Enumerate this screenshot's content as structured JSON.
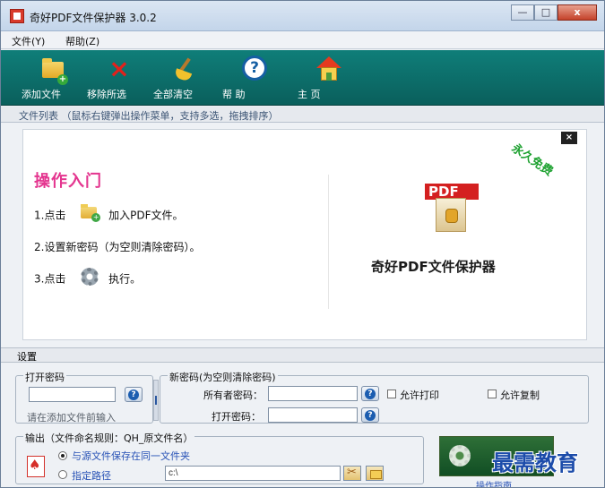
{
  "window": {
    "title": "奇好PDF文件保护器 3.0.2",
    "buttons": {
      "minimize": "—",
      "maximize": "□",
      "close": "x"
    }
  },
  "menu": {
    "file": "文件(Y)",
    "help": "帮助(Z)"
  },
  "toolbar": {
    "add_file": "添加文件",
    "remove_selected": "移除所选",
    "clear_all": "全部清空",
    "help": "帮 助",
    "home": "主 页"
  },
  "file_list": {
    "header": "文件列表 （鼠标右键弹出操作菜单，支持多选，拖拽排序）"
  },
  "start_panel": {
    "close_symbol": "×",
    "title": "操作入门",
    "step1_prefix": "1.点击",
    "step1_text": "加入PDF文件。",
    "step2_text": "2.设置新密码（为空则清除密码）。",
    "step3_prefix": "3.点击",
    "step3_text": "执行。",
    "stamp": "永久免费",
    "pdf_logo_text": "PDF",
    "product_name": "奇好PDF文件保护器"
  },
  "settings": {
    "header": "设置",
    "open_password": {
      "legend": "打开密码",
      "value": "",
      "hint": "请在添加文件前输入"
    },
    "new_password": {
      "legend": "新密码(为空则清除密码)",
      "owner_label": "所有者密码：",
      "owner_value": "",
      "open_label": "打开密码：",
      "open_value": "",
      "allow_print": "允许打印",
      "allow_copy": "允许复制"
    },
    "output": {
      "legend": "输出（文件命名规则：QH_原文件名）",
      "same_folder": "与源文件保存在同一文件夹",
      "specified_path": "指定路径",
      "path_value": "c:\\",
      "selected_mode": "same_folder"
    }
  },
  "action": {
    "caption": "操作指南"
  },
  "watermark": "最需教育",
  "colors": {
    "toolbar": "#0f7e79",
    "stamp": "#1da130",
    "pdf_red": "#d42020",
    "accent_pink": "#e4358f",
    "blue_text": "#2852b6"
  },
  "icons": {
    "add_file": "folder-plus-icon",
    "remove_selected": "red-x-icon",
    "clear_all": "broom-icon",
    "help": "question-icon",
    "home": "house-icon"
  }
}
